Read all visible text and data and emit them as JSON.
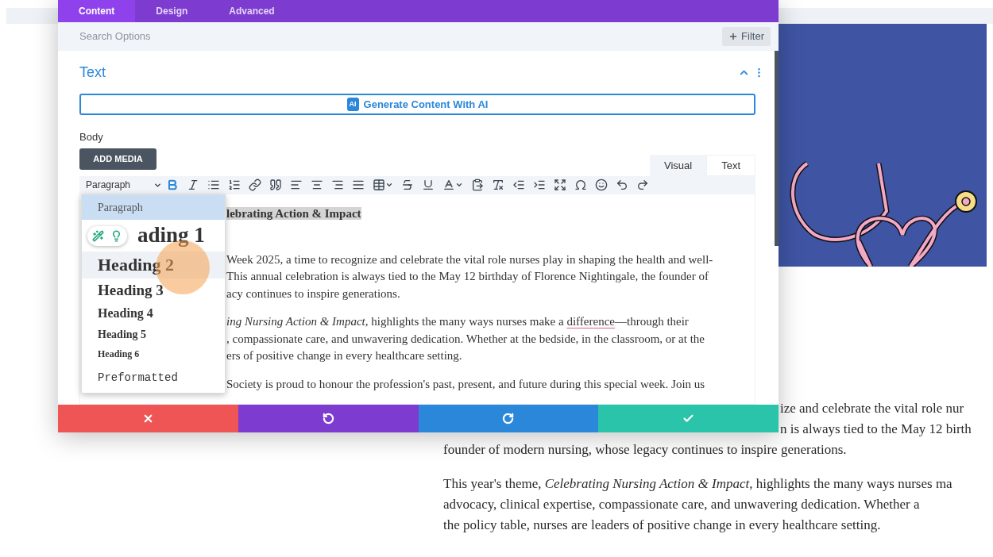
{
  "builder_tabs": [
    {
      "label": "Content",
      "selected": true
    },
    {
      "label": "Design",
      "selected": false
    },
    {
      "label": "Advanced",
      "selected": false
    }
  ],
  "search": {
    "placeholder": "Search Options"
  },
  "filter_button": {
    "label": "Filter"
  },
  "module": {
    "title": "Text",
    "expanded": true
  },
  "ai_button": {
    "badge": "AI",
    "label": "Generate Content With AI"
  },
  "body_label": "Body",
  "add_media_button": "ADD MEDIA",
  "editor_tabs": [
    {
      "label": "Visual",
      "selected": true
    },
    {
      "label": "Text",
      "selected": false
    }
  ],
  "toolbar": {
    "format_value": "Paragraph",
    "bold_active": true
  },
  "format_menu": [
    {
      "label": "Paragraph",
      "kind": "p",
      "selected": true,
      "hovered": false
    },
    {
      "label": "ading 1",
      "kind": "h1",
      "selected": false,
      "hovered": false
    },
    {
      "label": "Heading 2",
      "kind": "h2",
      "selected": false,
      "hovered": true
    },
    {
      "label": "Heading 3",
      "kind": "h3",
      "selected": false,
      "hovered": false
    },
    {
      "label": "Heading 4",
      "kind": "h4",
      "selected": false,
      "hovered": false
    },
    {
      "label": "Heading 5",
      "kind": "h5",
      "selected": false,
      "hovered": false
    },
    {
      "label": "Heading 6",
      "kind": "h6",
      "selected": false,
      "hovered": false
    },
    {
      "label": "Preformatted",
      "kind": "pre",
      "selected": false,
      "hovered": false
    }
  ],
  "editor_paragraphs": [
    {
      "kind": "heading",
      "lines": [
        [
          {
            "text": "lebrating Action & Impact",
            "kind": "plain"
          }
        ]
      ]
    },
    {
      "kind": "body",
      "lines": [
        [
          {
            "text": "Week 2025, a time to recognize and celebrate the vital role nurses play in shaping the health and well-",
            "kind": "plain"
          }
        ],
        [
          {
            "text": "This annual celebration is always tied to the May 12 birthday of Florence Nightingale, the founder of",
            "kind": "plain"
          }
        ],
        [
          {
            "text": "acy continues to inspire generations.",
            "kind": "plain"
          }
        ]
      ]
    },
    {
      "kind": "body",
      "lines": [
        [
          {
            "text": "*ing Nursing Action & Impact*, highlights the many ways nurses make a ",
            "kind": "plain"
          },
          {
            "text": "difference",
            "kind": "misspelled"
          },
          {
            "text": "—through their",
            "kind": "plain"
          }
        ],
        [
          {
            "text": ", compassionate care, and unwavering dedication. Whether at the bedside, in the classroom, or at the",
            "kind": "plain"
          }
        ],
        [
          {
            "text": "ers of positive change in every healthcare setting.",
            "kind": "plain"
          }
        ]
      ]
    },
    {
      "kind": "body",
      "lines": [
        [
          {
            "text": "Society is proud to honour the profession's past, present, and future during this special week. Join us",
            "kind": "plain"
          }
        ]
      ]
    }
  ],
  "action_bar": [
    {
      "kind": "cancel",
      "color": "#ef5555"
    },
    {
      "kind": "undo",
      "color": "#7e3bd0"
    },
    {
      "kind": "redo",
      "color": "#2b87da"
    },
    {
      "kind": "save",
      "color": "#29c4a9"
    }
  ],
  "page_paragraphs": [
    {
      "lines": [
        {
          "text": "ize and celebrate the vital role nur",
          "kind": "fragment"
        },
        {
          "text": "n is always tied to the May 12 birth",
          "kind": "fragment"
        },
        {
          "text": "founder of modern nursing, whose legacy continues to inspire generations.",
          "kind": "full"
        }
      ]
    },
    {
      "lines": [
        {
          "text": "This year's theme, *Celebrating Nursing Action & Impact*, highlights the many ways nurses ma",
          "kind": "full"
        },
        {
          "text": "advocacy, clinical expertise, compassionate care, and unwavering dedication. Whether a",
          "kind": "full"
        },
        {
          "text": "the policy table, nurses are leaders of positive change in every healthcare setting.",
          "kind": "full"
        }
      ]
    }
  ]
}
